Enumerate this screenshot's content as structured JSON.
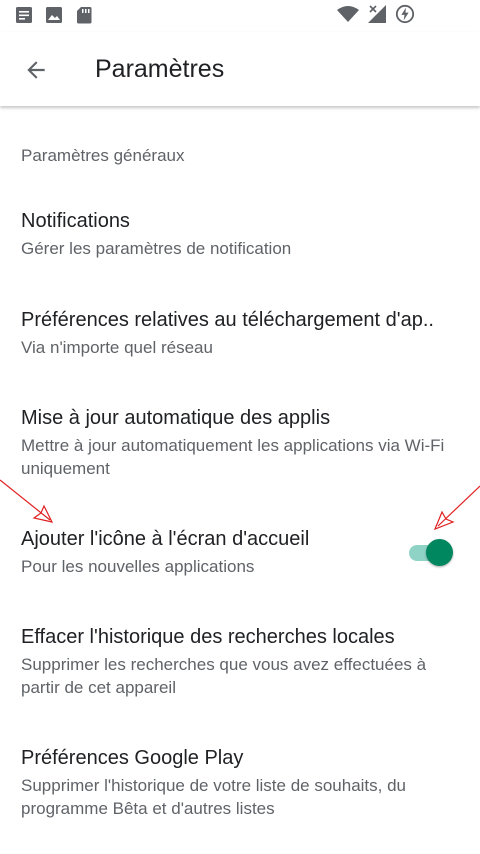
{
  "status_bar": {
    "left_icons": [
      "document-icon",
      "image-icon",
      "sd-card-icon"
    ],
    "right_icons": [
      "wifi-icon",
      "signal-off-icon",
      "battery-charging-icon"
    ]
  },
  "app_bar": {
    "title": "Paramètres",
    "back_icon": "arrow-left-icon"
  },
  "section": {
    "title": "Paramètres généraux"
  },
  "items": [
    {
      "title": "Notifications",
      "subtitle": "Gérer les paramètres de notification"
    },
    {
      "title": "Préférences relatives au téléchargement d'ap..",
      "subtitle": "Via n'importe quel réseau"
    },
    {
      "title": "Mise à jour automatique des applis",
      "subtitle": "Mettre à jour automatiquement les applications via Wi-Fi uniquement"
    },
    {
      "title": "Ajouter l'icône à l'écran d'accueil",
      "subtitle": "Pour les nouvelles applications",
      "toggle": true
    },
    {
      "title": "Effacer l'historique des recherches locales",
      "subtitle": "Supprimer les recherches que vous avez effectuées à partir de cet appareil"
    },
    {
      "title": "Préférences Google Play",
      "subtitle": "Supprimer l'historique de votre liste de souhaits, du programme Bêta et d'autres listes"
    }
  ],
  "colors": {
    "accent": "#01875f",
    "toggle_track": "#8fd3c6",
    "annotation": "#e02020"
  }
}
